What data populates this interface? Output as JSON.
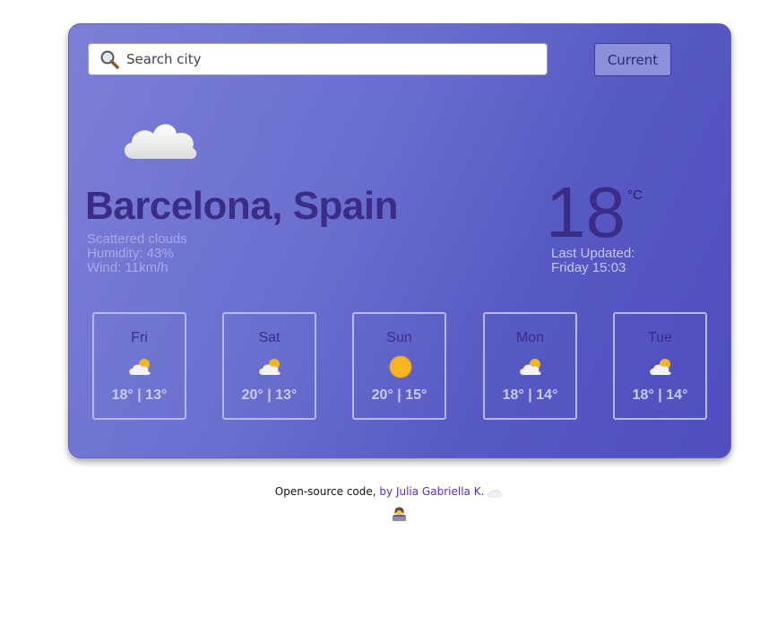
{
  "search": {
    "placeholder": "Search city"
  },
  "current_button": {
    "label": "Current"
  },
  "weather": {
    "icon": "cloud-icon",
    "city": "Barcelona, Spain",
    "description": "Scattered clouds",
    "humidity": "Humidity: 43%",
    "wind": "Wind: 11km/h",
    "temperature": "18",
    "unit": "°C",
    "updated_label": "Last Updated:",
    "updated_time": "Friday 15:03"
  },
  "forecast": [
    {
      "day": "Fri",
      "icon": "partly-cloudy-icon",
      "temps": "18° | 13°"
    },
    {
      "day": "Sat",
      "icon": "partly-cloudy-icon",
      "temps": "20° | 13°"
    },
    {
      "day": "Sun",
      "icon": "sun-icon",
      "temps": "20° | 15°"
    },
    {
      "day": "Mon",
      "icon": "partly-cloudy-icon",
      "temps": "18° | 14°"
    },
    {
      "day": "Tue",
      "icon": "partly-cloudy-icon",
      "temps": "18° | 14°"
    }
  ],
  "footer": {
    "text": "Open-source code,",
    "link_text": "by Julia Gabriella K.",
    "cloud_icon": "cloud-icon",
    "emoji_icon": "woman-technologist-icon"
  },
  "colors": {
    "card_gradient_start": "#7b7fd6",
    "card_gradient_end": "#4f4fbf",
    "accent_dark": "#3b2d86",
    "link": "#5a2bc4"
  }
}
